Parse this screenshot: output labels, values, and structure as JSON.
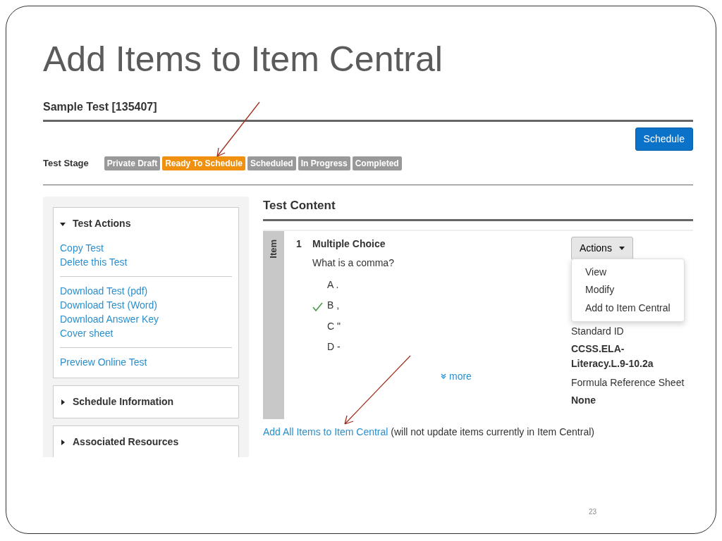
{
  "slide": {
    "title": "Add Items to Item Central",
    "page_number": "23"
  },
  "test": {
    "title": "Sample Test [135407]",
    "schedule_button": "Schedule",
    "stage_label": "Test Stage",
    "stages": [
      {
        "label": "Private Draft",
        "selected": false
      },
      {
        "label": "Ready To Schedule",
        "selected": true
      },
      {
        "label": "Scheduled",
        "selected": false
      },
      {
        "label": "In Progress",
        "selected": false
      },
      {
        "label": "Completed",
        "selected": false
      }
    ]
  },
  "sidebar": {
    "panels": [
      {
        "title": "Test Actions",
        "expanded": true,
        "groups": [
          {
            "links": [
              "Copy Test",
              "Delete this Test"
            ]
          },
          {
            "links": [
              "Download Test (pdf)",
              "Download Test (Word)",
              "Download Answer Key",
              "Cover sheet"
            ]
          },
          {
            "links": [
              "Preview Online Test"
            ]
          }
        ]
      },
      {
        "title": "Schedule Information",
        "expanded": false
      },
      {
        "title": "Associated Resources",
        "expanded": false
      }
    ]
  },
  "content": {
    "title": "Test Content",
    "side_label": "Item",
    "items": [
      {
        "number": "1",
        "type": "Multiple Choice",
        "question": "What is a comma?",
        "choices": [
          {
            "letter": "A",
            "text": ".",
            "correct": false
          },
          {
            "letter": "B",
            "text": ",",
            "correct": true
          },
          {
            "letter": "C",
            "text": "\"",
            "correct": false
          },
          {
            "letter": "D",
            "text": "-",
            "correct": false
          }
        ],
        "more": "more",
        "actions_button": "Actions",
        "menu": {
          "open": true,
          "items": [
            "View",
            "Modify",
            "Add to Item Central"
          ]
        },
        "details": [
          {
            "label": "Standard ID",
            "value": "CCSS.ELA-Literacy.L.9-10.2a"
          },
          {
            "label": "Formula Reference Sheet",
            "value": "None"
          }
        ]
      }
    ],
    "add_all_link": "Add All Items to Item Central",
    "add_all_note": "(will not update items currently in Item Central)"
  }
}
